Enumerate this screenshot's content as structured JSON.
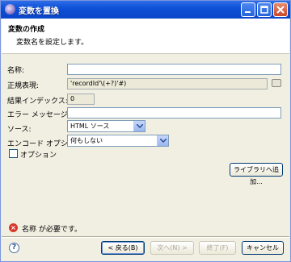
{
  "window": {
    "title": "変数を置換"
  },
  "banner": {
    "title": "変数の作成",
    "description": "変数名を設定します。"
  },
  "form": {
    "name_label": "名称:",
    "name_value": "",
    "regex_label": "正規表現:",
    "regex_value": "'recordId'\\(+?)'#)",
    "group_label": "結果インデックス:",
    "group_value": "0",
    "error_label": "エラー メッセージ:",
    "error_value": "",
    "source_label": "ソース:",
    "source_value": "HTML ソース",
    "encode_label": "エンコード オプション:",
    "encode_value": "何もしない",
    "option_label": "オプション",
    "library_button": "ライブラリへ追加..."
  },
  "status": {
    "error_message": "名称 が必要です。"
  },
  "footer": {
    "back_button": "< 戻る(B)",
    "next_button": "次へ(N) >",
    "finish_button": "終了(F)",
    "cancel_button": "キャンセル"
  },
  "icons": {
    "window": "app-icon",
    "minimize": "minimize-icon",
    "maximize": "maximize-icon",
    "close": "close-icon",
    "error": "error-icon",
    "help": "help-icon"
  }
}
